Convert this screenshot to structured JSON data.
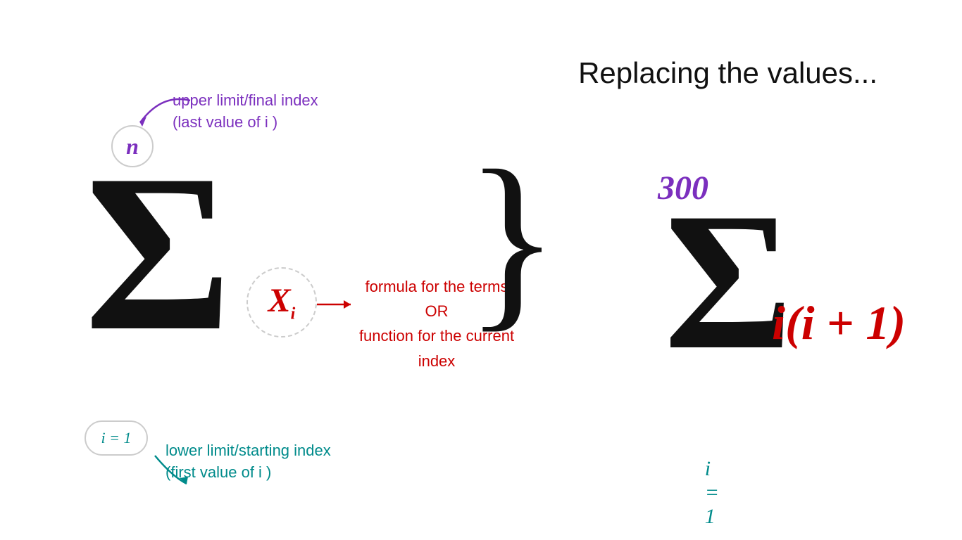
{
  "title": "Replacing the values...",
  "left": {
    "sigma": "Σ",
    "n_label": "n",
    "i1_label": "i = 1",
    "xi_label": "X",
    "xi_sub": "i",
    "upper_annotation_line1": "upper limit/final index",
    "upper_annotation_line2": "(last value of i )",
    "lower_annotation_line1": "lower limit/starting index",
    "lower_annotation_line2": "(first value of i )",
    "formula_annotation_line1": "formula for the terms",
    "formula_annotation_line2": "OR",
    "formula_annotation_line3": "function for the current index"
  },
  "curly_brace": "}",
  "right": {
    "sigma": "Σ",
    "upper_limit": "300",
    "lower_limit": "i = 1",
    "formula": "i(i + 1)"
  }
}
